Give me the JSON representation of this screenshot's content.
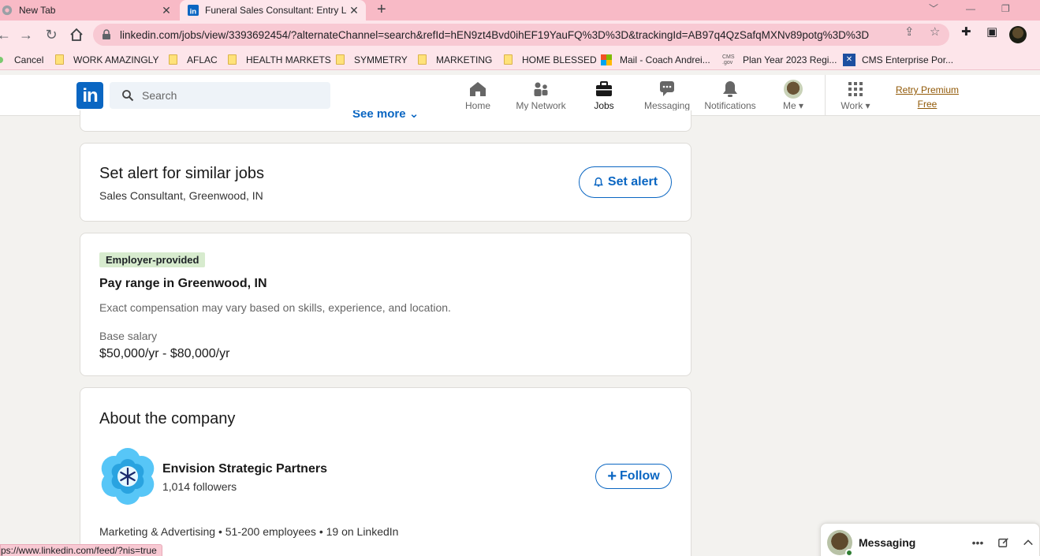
{
  "browser": {
    "tabs": [
      {
        "title": "New Tab",
        "icon": "chrome-icon"
      },
      {
        "title": "Funeral Sales Consultant: Entry Le",
        "icon": "linkedin-icon"
      }
    ],
    "new_tab_symbol": "+",
    "url": "linkedin.com/jobs/view/3393692454/?alternateChannel=search&refId=hEN9zt4Bvd0ihEF19YauFQ%3D%3D&trackingId=AB97q4QzSafqMXNv89potg%3D%3D",
    "bookmarks": [
      {
        "label": "Cancel",
        "icon": "dot-icon"
      },
      {
        "label": "WORK AMAZINGLY",
        "icon": "folder-icon"
      },
      {
        "label": "AFLAC",
        "icon": "folder-icon"
      },
      {
        "label": "HEALTH MARKETS",
        "icon": "folder-icon"
      },
      {
        "label": "SYMMETRY",
        "icon": "folder-icon"
      },
      {
        "label": "MARKETING",
        "icon": "folder-icon"
      },
      {
        "label": "HOME BLESSED",
        "icon": "folder-icon"
      },
      {
        "label": "Mail - Coach Andrei...",
        "icon": "microsoft-icon"
      },
      {
        "label": "Plan Year 2023 Regi...",
        "icon": "cms-gov-icon"
      },
      {
        "label": "CMS Enterprise Por...",
        "icon": "cms-enterprise-icon"
      }
    ],
    "status_url": "ps://www.linkedin.com/feed/?nis=true"
  },
  "linkedin_nav": {
    "logo_text": "in",
    "search_placeholder": "Search",
    "items": [
      {
        "label": "Home",
        "icon": "home-icon"
      },
      {
        "label": "My Network",
        "icon": "network-icon"
      },
      {
        "label": "Jobs",
        "icon": "briefcase-icon"
      },
      {
        "label": "Messaging",
        "icon": "messaging-icon"
      },
      {
        "label": "Notifications",
        "icon": "bell-icon"
      },
      {
        "label": "Me",
        "icon": "avatar"
      },
      {
        "label": "Work",
        "icon": "grid-icon"
      }
    ],
    "active_item": "Jobs",
    "premium_line1": "Retry Premium",
    "premium_line2": "Free"
  },
  "see_more": "See more",
  "alert_card": {
    "title": "Set alert for similar jobs",
    "subtitle": "Sales Consultant, Greenwood, IN",
    "button": "Set alert"
  },
  "pay_card": {
    "badge": "Employer-provided",
    "title": "Pay range in Greenwood, IN",
    "note": "Exact compensation may vary based on skills, experience, and location.",
    "base_label": "Base salary",
    "base_value": "$50,000/yr - $80,000/yr"
  },
  "company_card": {
    "heading": "About the company",
    "name": "Envision Strategic Partners",
    "followers": "1,014 followers",
    "follow_button": "Follow",
    "meta": "Marketing & Advertising • 51-200 employees • 19 on LinkedIn"
  },
  "messaging": {
    "label": "Messaging"
  },
  "colors": {
    "linkedin_blue": "#0a66c2",
    "tab_strip": "#f8bac6",
    "badge_green": "#d7ebce",
    "premium_gold": "#915907"
  }
}
